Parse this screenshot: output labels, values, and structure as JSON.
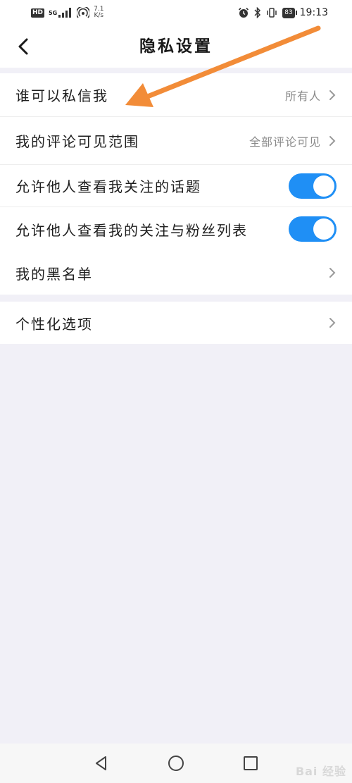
{
  "status_bar": {
    "hd": "HD",
    "network": "5G",
    "speed_value": "7.1",
    "speed_unit": "K/s",
    "battery": "83",
    "time": "19:13"
  },
  "header": {
    "title": "隐私设置",
    "back_icon": "chevron-left-icon"
  },
  "settings": {
    "items": [
      {
        "label": "谁可以私信我",
        "value": "所有人",
        "control": "chevron"
      },
      {
        "label": "我的评论可见范围",
        "value": "全部评论可见",
        "control": "chevron"
      },
      {
        "label": "允许他人查看我关注的话题",
        "control": "toggle",
        "on": true
      },
      {
        "label": "允许他人查看我的关注与粉丝列表",
        "control": "toggle",
        "on": true
      },
      {
        "label": "我的黑名单",
        "control": "chevron"
      },
      {
        "label": "个性化选项",
        "control": "chevron"
      }
    ]
  },
  "colors": {
    "accent": "#1f8ff5",
    "annotation": "#f28c38",
    "background": "#f1f0f7"
  },
  "watermark": "Bai 经验"
}
